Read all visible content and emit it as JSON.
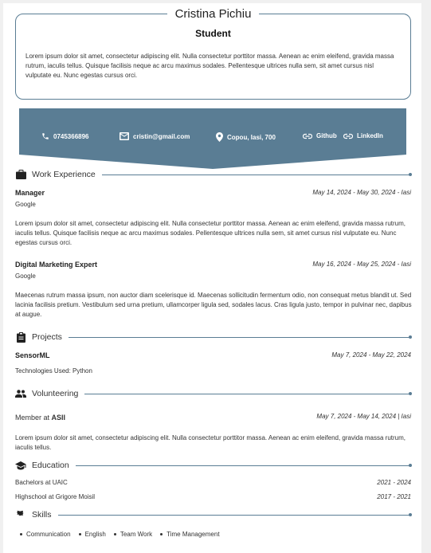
{
  "header": {
    "name": "Cristina Pichiu",
    "role": "Student",
    "summary": "Lorem ipsum dolor sit amet, consectetur adipiscing elit. Nulla consectetur porttitor massa. Aenean ac enim eleifend, gravida massa rutrum, iaculis tellus. Quisque facilisis neque ac arcu maximus sodales. Pellentesque ultrices nulla sem, sit amet cursus nisl vulputate eu. Nunc egestas cursus orci."
  },
  "contact": {
    "phone": "0745366896",
    "email": "cristin@gmail.com",
    "location": "Copou, Iasi, 700",
    "github": "Github",
    "linkedin": "LinkedIn"
  },
  "colors": {
    "accent": "#5a7d94"
  },
  "work": {
    "title": "Work Experience",
    "items": [
      {
        "role": "Manager",
        "company": "Google",
        "dates": "May 14, 2024 - May 30, 2024 - Iasi",
        "description": "Lorem ipsum dolor sit amet, consectetur adipiscing elit. Nulla consectetur porttitor massa. Aenean ac enim eleifend, gravida massa rutrum, iaculis tellus. Quisque facilisis neque ac arcu maximus sodales. Pellentesque ultrices nulla sem, sit amet cursus nisl vulputate eu. Nunc egestas cursus orci."
      },
      {
        "role": "Digital Marketing Expert",
        "company": "Google",
        "dates": "May 16, 2024 - May 25, 2024 - Iasi",
        "description": "Maecenas rutrum massa ipsum, non auctor diam scelerisque id. Maecenas sollicitudin fermentum odio, non consequat metus blandit ut. Sed lacinia facilisis pretium. Vestibulum sed urna pretium, ullamcorper ligula sed, sodales lacus. Cras ligula justo, tempor in pulvinar nec, dapibus at augue."
      }
    ]
  },
  "projects": {
    "title": "Projects",
    "items": [
      {
        "name": "SensorML",
        "dates": "May 7, 2024 - May 22, 2024",
        "tech": "Technologies Used: Python"
      }
    ]
  },
  "volunteering": {
    "title": "Volunteering",
    "items": [
      {
        "role_prefix": "Member at",
        "org": "ASII",
        "dates": "May 7, 2024 - May 14, 2024 | Iasi",
        "description": "Lorem ipsum dolor sit amet, consectetur adipiscing elit. Nulla consectetur porttitor massa. Aenean ac enim eleifend, gravida massa rutrum, iaculis tellus."
      }
    ]
  },
  "education": {
    "title": "Education",
    "items": [
      {
        "name": "Bachelors at UAIC",
        "dates": "2021 - 2024"
      },
      {
        "name": "Highschool at Grigore Moisil",
        "dates": "2017 - 2021"
      }
    ]
  },
  "skills": {
    "title": "Skills",
    "items": [
      "Communication",
      "English",
      "Team Work",
      "Time Management"
    ]
  }
}
